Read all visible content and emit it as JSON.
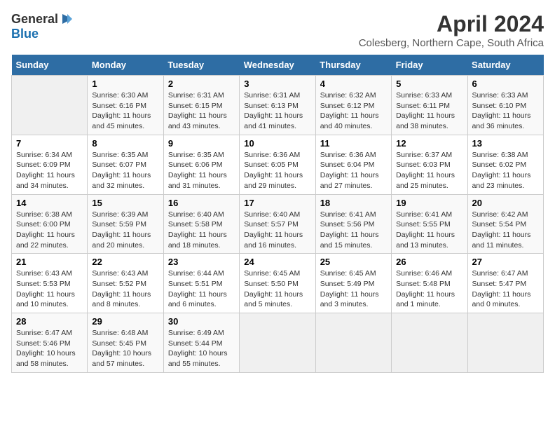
{
  "header": {
    "logo": {
      "general": "General",
      "blue": "Blue"
    },
    "title": "April 2024",
    "subtitle": "Colesberg, Northern Cape, South Africa"
  },
  "weekdays": [
    "Sunday",
    "Monday",
    "Tuesday",
    "Wednesday",
    "Thursday",
    "Friday",
    "Saturday"
  ],
  "weeks": [
    [
      {
        "day": "",
        "info": ""
      },
      {
        "day": "1",
        "info": "Sunrise: 6:30 AM\nSunset: 6:16 PM\nDaylight: 11 hours\nand 45 minutes."
      },
      {
        "day": "2",
        "info": "Sunrise: 6:31 AM\nSunset: 6:15 PM\nDaylight: 11 hours\nand 43 minutes."
      },
      {
        "day": "3",
        "info": "Sunrise: 6:31 AM\nSunset: 6:13 PM\nDaylight: 11 hours\nand 41 minutes."
      },
      {
        "day": "4",
        "info": "Sunrise: 6:32 AM\nSunset: 6:12 PM\nDaylight: 11 hours\nand 40 minutes."
      },
      {
        "day": "5",
        "info": "Sunrise: 6:33 AM\nSunset: 6:11 PM\nDaylight: 11 hours\nand 38 minutes."
      },
      {
        "day": "6",
        "info": "Sunrise: 6:33 AM\nSunset: 6:10 PM\nDaylight: 11 hours\nand 36 minutes."
      }
    ],
    [
      {
        "day": "7",
        "info": "Sunrise: 6:34 AM\nSunset: 6:09 PM\nDaylight: 11 hours\nand 34 minutes."
      },
      {
        "day": "8",
        "info": "Sunrise: 6:35 AM\nSunset: 6:07 PM\nDaylight: 11 hours\nand 32 minutes."
      },
      {
        "day": "9",
        "info": "Sunrise: 6:35 AM\nSunset: 6:06 PM\nDaylight: 11 hours\nand 31 minutes."
      },
      {
        "day": "10",
        "info": "Sunrise: 6:36 AM\nSunset: 6:05 PM\nDaylight: 11 hours\nand 29 minutes."
      },
      {
        "day": "11",
        "info": "Sunrise: 6:36 AM\nSunset: 6:04 PM\nDaylight: 11 hours\nand 27 minutes."
      },
      {
        "day": "12",
        "info": "Sunrise: 6:37 AM\nSunset: 6:03 PM\nDaylight: 11 hours\nand 25 minutes."
      },
      {
        "day": "13",
        "info": "Sunrise: 6:38 AM\nSunset: 6:02 PM\nDaylight: 11 hours\nand 23 minutes."
      }
    ],
    [
      {
        "day": "14",
        "info": "Sunrise: 6:38 AM\nSunset: 6:00 PM\nDaylight: 11 hours\nand 22 minutes."
      },
      {
        "day": "15",
        "info": "Sunrise: 6:39 AM\nSunset: 5:59 PM\nDaylight: 11 hours\nand 20 minutes."
      },
      {
        "day": "16",
        "info": "Sunrise: 6:40 AM\nSunset: 5:58 PM\nDaylight: 11 hours\nand 18 minutes."
      },
      {
        "day": "17",
        "info": "Sunrise: 6:40 AM\nSunset: 5:57 PM\nDaylight: 11 hours\nand 16 minutes."
      },
      {
        "day": "18",
        "info": "Sunrise: 6:41 AM\nSunset: 5:56 PM\nDaylight: 11 hours\nand 15 minutes."
      },
      {
        "day": "19",
        "info": "Sunrise: 6:41 AM\nSunset: 5:55 PM\nDaylight: 11 hours\nand 13 minutes."
      },
      {
        "day": "20",
        "info": "Sunrise: 6:42 AM\nSunset: 5:54 PM\nDaylight: 11 hours\nand 11 minutes."
      }
    ],
    [
      {
        "day": "21",
        "info": "Sunrise: 6:43 AM\nSunset: 5:53 PM\nDaylight: 11 hours\nand 10 minutes."
      },
      {
        "day": "22",
        "info": "Sunrise: 6:43 AM\nSunset: 5:52 PM\nDaylight: 11 hours\nand 8 minutes."
      },
      {
        "day": "23",
        "info": "Sunrise: 6:44 AM\nSunset: 5:51 PM\nDaylight: 11 hours\nand 6 minutes."
      },
      {
        "day": "24",
        "info": "Sunrise: 6:45 AM\nSunset: 5:50 PM\nDaylight: 11 hours\nand 5 minutes."
      },
      {
        "day": "25",
        "info": "Sunrise: 6:45 AM\nSunset: 5:49 PM\nDaylight: 11 hours\nand 3 minutes."
      },
      {
        "day": "26",
        "info": "Sunrise: 6:46 AM\nSunset: 5:48 PM\nDaylight: 11 hours\nand 1 minute."
      },
      {
        "day": "27",
        "info": "Sunrise: 6:47 AM\nSunset: 5:47 PM\nDaylight: 11 hours\nand 0 minutes."
      }
    ],
    [
      {
        "day": "28",
        "info": "Sunrise: 6:47 AM\nSunset: 5:46 PM\nDaylight: 10 hours\nand 58 minutes."
      },
      {
        "day": "29",
        "info": "Sunrise: 6:48 AM\nSunset: 5:45 PM\nDaylight: 10 hours\nand 57 minutes."
      },
      {
        "day": "30",
        "info": "Sunrise: 6:49 AM\nSunset: 5:44 PM\nDaylight: 10 hours\nand 55 minutes."
      },
      {
        "day": "",
        "info": ""
      },
      {
        "day": "",
        "info": ""
      },
      {
        "day": "",
        "info": ""
      },
      {
        "day": "",
        "info": ""
      }
    ]
  ]
}
